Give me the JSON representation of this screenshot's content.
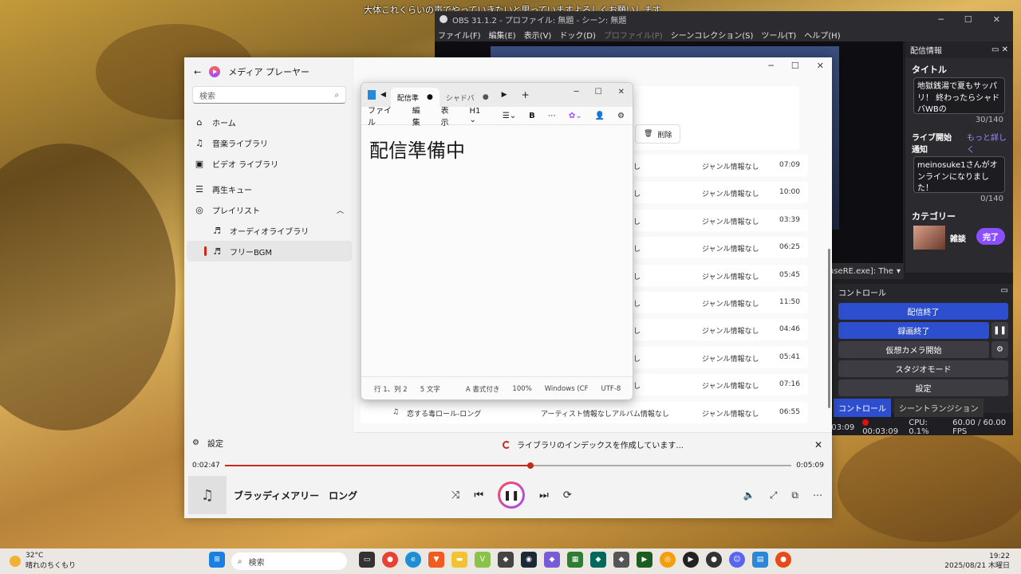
{
  "caption": "大体これくらいの声でやっていきたいと思っていますよろしくお願いします",
  "obs": {
    "title": "OBS 31.1.2 - プロファイル: 無題 - シーン: 無題",
    "menus": [
      "ファイル(F)",
      "編集(E)",
      "表示(V)",
      "ドック(D)",
      "プロファイル(P)",
      "シーンコレクション(S)",
      "ツール(T)",
      "ヘルプ(H)"
    ],
    "info_header": "配信情報",
    "title_label": "タイトル",
    "title_value": "地獄銭湯で夏もサッパリ！ 終わったらシャドバWBの",
    "title_count": "30/140",
    "notify_label": "ライブ開始通知",
    "more_link": "もっと詳しく",
    "notify_value": "meinosuke1さんがオンラインになりました！",
    "notify_count": "0/140",
    "category_label": "カテゴリー",
    "category_value": "雑談",
    "done": "完了",
    "source_text": "useRE.exe]: The",
    "controls_header": "コントロール",
    "buttons": {
      "stop_stream": "配信終了",
      "stop_rec": "録画終了",
      "vcam": "仮想カメラ開始",
      "studio": "スタジオモード",
      "settings": "設定"
    },
    "tabs": [
      "コントロール",
      "シーントランジション"
    ],
    "status": {
      "t1": ":03:09",
      "t2": "00:03:09",
      "cpu": "CPU: 0.1%",
      "fps": "60.00 / 60.00 FPS"
    }
  },
  "player": {
    "app_title": "メディア プレーヤー",
    "search_placeholder": "検索",
    "nav": {
      "home": "ホーム",
      "music": "音楽ライブラリ",
      "video": "ビデオ ライブラリ",
      "queue": "再生キュー",
      "playlist": "プレイリスト",
      "audio_lib": "オーディオライブラリ",
      "free_bgm": "フリーBGM"
    },
    "settings": "設定",
    "delete": "削除",
    "rows": [
      {
        "title": "",
        "artist": "",
        "album": "情報なし",
        "genre": "ジャンル情報なし",
        "time": "07:09"
      },
      {
        "title": "",
        "artist": "",
        "album": "情報なし",
        "genre": "ジャンル情報なし",
        "time": "10:00"
      },
      {
        "title": "",
        "artist": "",
        "album": "情報なし",
        "genre": "ジャンル情報なし",
        "time": "03:39"
      },
      {
        "title": "",
        "artist": "",
        "album": "情報なし",
        "genre": "ジャンル情報なし",
        "time": "06:25"
      },
      {
        "title": "",
        "artist": "",
        "album": "情報なし",
        "genre": "ジャンル情報なし",
        "time": "05:45"
      },
      {
        "title": "",
        "artist": "",
        "album": "情報なし",
        "genre": "ジャンル情報なし",
        "time": "11:50"
      },
      {
        "title": "",
        "artist": "",
        "album": "情報なし",
        "genre": "ジャンル情報なし",
        "time": "04:46"
      },
      {
        "title": "",
        "artist": "",
        "album": "情報なし",
        "genre": "ジャンル情報なし",
        "time": "05:41"
      },
      {
        "title": "",
        "artist": "",
        "album": "情報なし",
        "genre": "ジャンル情報なし",
        "time": "07:16"
      },
      {
        "title": "恋する毒ロール-ロング",
        "artist": "アーティスト情報なし",
        "album": "アルバム情報なし",
        "genre": "ジャンル情報なし",
        "time": "06:55"
      }
    ],
    "indexing": "ライブラリのインデックスを作成しています...",
    "elapsed": "0:02:47",
    "duration": "0:05:09",
    "progress_fraction": 0.54,
    "song": "ブラッディメアリー　ロング"
  },
  "notepad": {
    "tabs": [
      "配信準",
      "シャドバ"
    ],
    "menus": [
      "ファイル",
      "編集",
      "表示"
    ],
    "heading_select": "H1",
    "bold": "B",
    "content": "配信準備中",
    "status": {
      "pos": "行 1、列 2",
      "chars": "5 文字",
      "format": "書式付き",
      "zoom": "100%",
      "eol": "Windows (CF",
      "enc": "UTF-8"
    }
  },
  "taskbar": {
    "temp": "32°C",
    "weather": "晴れのちくもり",
    "search": "検索",
    "time": "19:22",
    "date": "2025/08/21 木曜日"
  }
}
